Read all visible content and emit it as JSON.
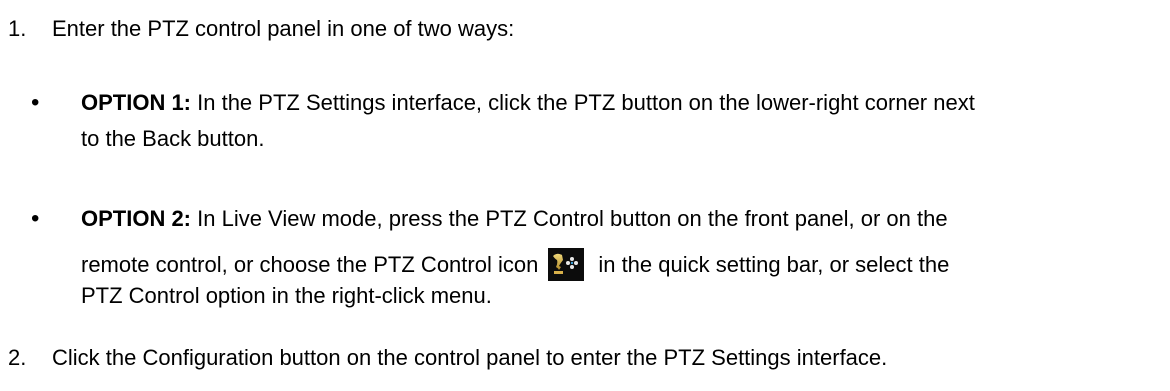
{
  "steps": [
    {
      "number": "1.",
      "text": "Enter the PTZ control panel in one of two ways:"
    },
    {
      "number": "2.",
      "text": "Click the Configuration button on the control panel to enter the PTZ Settings interface."
    }
  ],
  "options": [
    {
      "label": "OPTION 1:",
      "line1": " In the PTZ Settings interface, click the PTZ button on the lower-right corner next",
      "line2": "to the Back button."
    },
    {
      "label": "OPTION 2:",
      "line1": " In Live View mode, press the PTZ Control button on the front panel, or on the",
      "line2_before_icon": "remote control, or choose the PTZ Control icon",
      "line2_after_icon": "in the quick setting bar, or select the",
      "line3": "PTZ Control option in the right-click menu."
    }
  ],
  "bullet_glyph": "•",
  "icons": {
    "ptz_control": "ptz-control-icon"
  }
}
